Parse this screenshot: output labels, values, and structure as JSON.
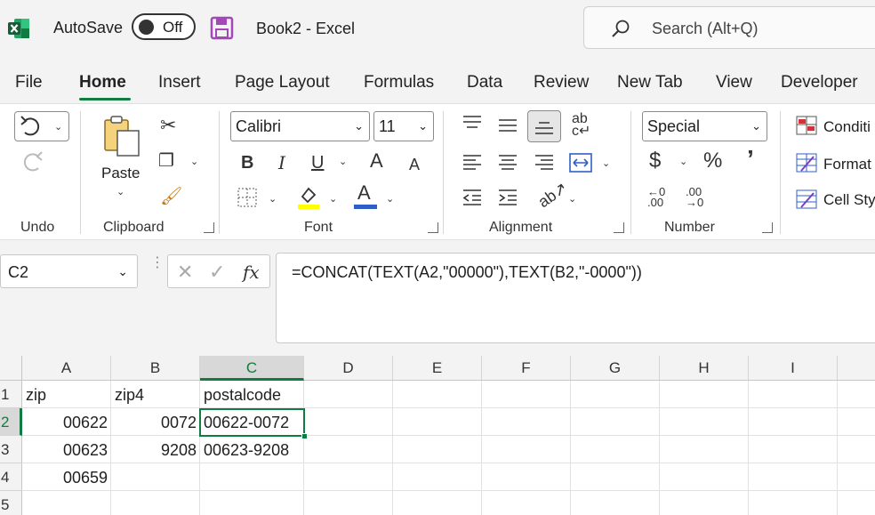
{
  "titlebar": {
    "autosave_label": "AutoSave",
    "autosave_state": "Off",
    "doc_title": "Book2  -  Excel",
    "search_placeholder": "Search (Alt+Q)"
  },
  "tabs": [
    "File",
    "Home",
    "Insert",
    "Page Layout",
    "Formulas",
    "Data",
    "Review",
    "New Tab",
    "View",
    "Developer"
  ],
  "active_tab": "Home",
  "ribbon": {
    "groups": {
      "undo": "Undo",
      "clipboard": "Clipboard",
      "font": "Font",
      "alignment": "Alignment",
      "number": "Number"
    },
    "paste_label": "Paste",
    "font_name": "Calibri",
    "font_size": "11",
    "number_format": "Special",
    "styles": [
      "Conditi",
      "Format",
      "Cell Sty"
    ],
    "font_buttons": {
      "bold": "B",
      "italic": "I",
      "underline": "U",
      "grow": "A",
      "shrink": "A",
      "font_color": "A"
    },
    "number_buttons": {
      "currency": "$",
      "percent": "%",
      "comma": "’"
    }
  },
  "formula_bar": {
    "name_box": "C2",
    "fx": "fx",
    "formula": "=CONCAT(TEXT(A2,\"00000\"),TEXT(B2,\"-0000\"))"
  },
  "grid": {
    "columns": [
      "A",
      "B",
      "C",
      "D",
      "E",
      "F",
      "G",
      "H",
      "I"
    ],
    "rows": [
      "1",
      "2",
      "3",
      "4",
      "5"
    ],
    "cells": {
      "A1": "zip",
      "B1": "zip4",
      "C1": "postalcode",
      "A2": "00622",
      "B2": "0072",
      "C2": "00622-0072",
      "A3": "00623",
      "B3": "9208",
      "C3": "00623-9208",
      "A4": "00659"
    },
    "active_cell": "C2"
  },
  "colors": {
    "accent": "#107c41",
    "save_icon": "#a347ba"
  }
}
